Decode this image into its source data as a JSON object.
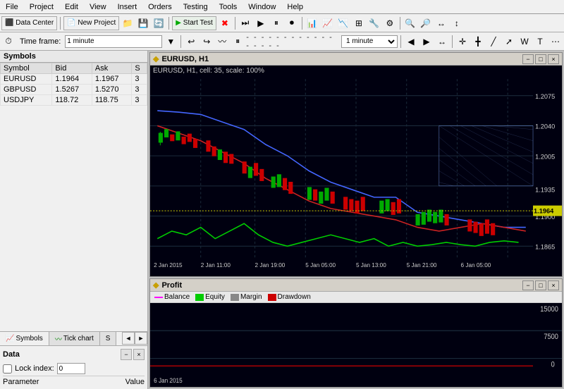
{
  "menubar": {
    "items": [
      "File",
      "Project",
      "Edit",
      "View",
      "Insert",
      "Orders",
      "Testing",
      "Tools",
      "Window",
      "Help"
    ]
  },
  "toolbar1": {
    "datacenter_label": "Data Center",
    "newproject_label": "New Project",
    "starttest_label": "Start Test",
    "timeframe_label": "Time frame:",
    "timeframe_value": "1 minute"
  },
  "toolbar2": {
    "timeframe_dropdown": "1 minute"
  },
  "symbols_panel": {
    "title": "Symbols",
    "columns": [
      "Symbol",
      "Bid",
      "Ask",
      "S"
    ],
    "rows": [
      {
        "symbol": "EURUSD",
        "bid": "1.1964",
        "ask": "1.1967",
        "s": "3"
      },
      {
        "symbol": "GBPUSD",
        "bid": "1.5267",
        "ask": "1.5270",
        "s": "3"
      },
      {
        "symbol": "USDJPY",
        "bid": "118.72",
        "ask": "118.75",
        "s": "3"
      }
    ]
  },
  "tabs": {
    "items": [
      "Symbols",
      "Tick chart",
      "S"
    ]
  },
  "data_panel": {
    "title": "Data",
    "lock_label": "Lock index:",
    "lock_value": "0",
    "col_parameter": "Parameter",
    "col_value": "Value"
  },
  "chart_main": {
    "title": "EURUSD, H1",
    "info": "EURUSD, H1, cell: 35, scale: 100%",
    "price_current": "1.1964",
    "prices": [
      "1.2075",
      "1.2040",
      "1.2005",
      "1.1935",
      "1.1900",
      "1.1865"
    ],
    "dates": [
      "2 Jan 2015",
      "2 Jan 11:00",
      "2 Jan 19:00",
      "5 Jan 05:00",
      "5 Jan 13:00",
      "5 Jan 21:00",
      "6 Jan 05:00"
    ]
  },
  "profit_window": {
    "title": "Profit",
    "legend": {
      "balance": "Balance",
      "equity": "Equity",
      "margin": "Margin",
      "drawdown": "Drawdown"
    },
    "y_labels": [
      "15000",
      "7500",
      "0"
    ],
    "x_label": "6 Jan 2015"
  },
  "icons": {
    "minimize": "−",
    "maximize": "□",
    "close": "×",
    "arrow_left": "◄",
    "arrow_right": "►",
    "chart_icon": "◆",
    "profit_icon": "◆"
  }
}
